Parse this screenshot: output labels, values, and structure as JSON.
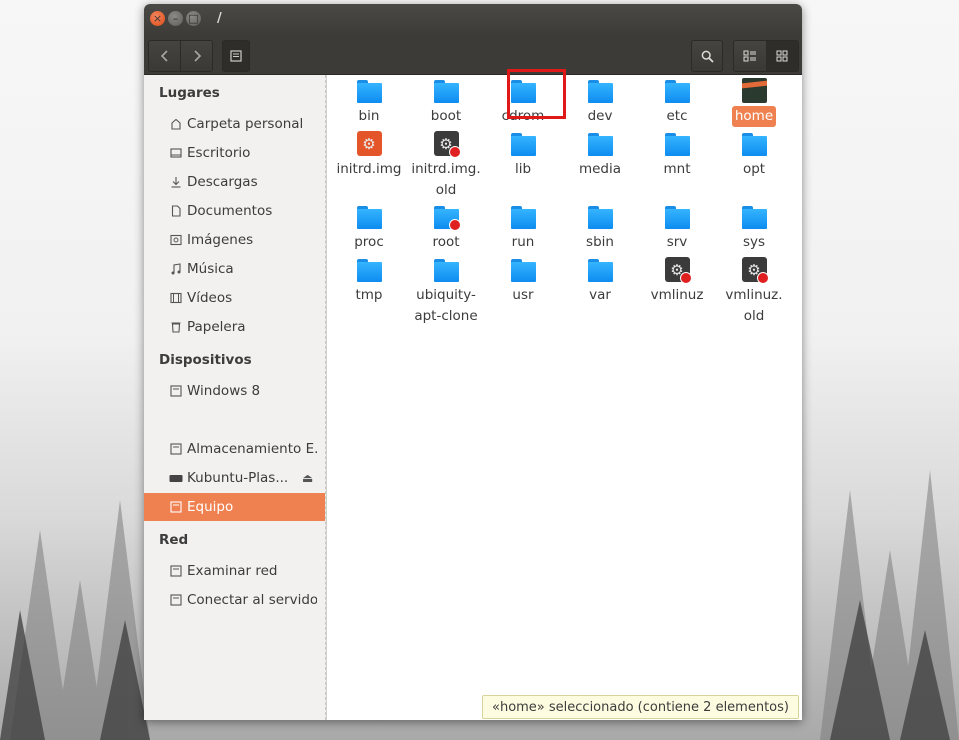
{
  "window": {
    "title": "/",
    "buttons": {
      "close": "×",
      "minimize": "–",
      "maximize": "□"
    }
  },
  "toolbar": {
    "back_icon": "chevron-left-icon",
    "forward_icon": "chevron-right-icon",
    "path_icon": "drive-icon",
    "search_icon": "search-icon",
    "list_view_icon": "list-view-icon",
    "grid_view_icon": "grid-view-icon"
  },
  "sidebar": {
    "sections": [
      {
        "heading": "Lugares",
        "items": [
          {
            "label": "Carpeta personal",
            "icon": "home-icon"
          },
          {
            "label": "Escritorio",
            "icon": "desktop-icon"
          },
          {
            "label": "Descargas",
            "icon": "download-icon"
          },
          {
            "label": "Documentos",
            "icon": "document-icon"
          },
          {
            "label": "Imágenes",
            "icon": "image-icon"
          },
          {
            "label": "Música",
            "icon": "music-icon"
          },
          {
            "label": "Vídeos",
            "icon": "video-icon"
          },
          {
            "label": "Papelera",
            "icon": "trash-icon"
          }
        ]
      },
      {
        "heading": "Dispositivos",
        "items": [
          {
            "label": "Windows 8",
            "icon": "drive-icon"
          },
          {
            "label": "Almacenamiento E...",
            "icon": "drive-icon"
          },
          {
            "label": "Kubuntu-Plas...",
            "icon": "disc-icon",
            "eject": "⏏"
          },
          {
            "label": "Equipo",
            "icon": "computer-icon",
            "selected": true
          }
        ]
      },
      {
        "heading": "Red",
        "items": [
          {
            "label": "Examinar red",
            "icon": "network-icon"
          },
          {
            "label": "Conectar al servidor",
            "icon": "server-icon"
          }
        ]
      }
    ]
  },
  "files": [
    {
      "name": "bin",
      "type": "folder"
    },
    {
      "name": "boot",
      "type": "folder"
    },
    {
      "name": "cdrom",
      "type": "folder"
    },
    {
      "name": "dev",
      "type": "folder"
    },
    {
      "name": "etc",
      "type": "folder",
      "highlighted": true
    },
    {
      "name": "home",
      "type": "home",
      "selected": true
    },
    {
      "name": "initrd.img",
      "type": "exec-orange"
    },
    {
      "name": "initrd.img.\nold",
      "type": "exec-locked"
    },
    {
      "name": "lib",
      "type": "folder"
    },
    {
      "name": "media",
      "type": "folder"
    },
    {
      "name": "mnt",
      "type": "folder"
    },
    {
      "name": "opt",
      "type": "folder"
    },
    {
      "name": "proc",
      "type": "folder"
    },
    {
      "name": "root",
      "type": "folder-locked"
    },
    {
      "name": "run",
      "type": "folder"
    },
    {
      "name": "sbin",
      "type": "folder"
    },
    {
      "name": "srv",
      "type": "folder"
    },
    {
      "name": "sys",
      "type": "folder"
    },
    {
      "name": "tmp",
      "type": "folder"
    },
    {
      "name": "ubiquity-\napt-clone",
      "type": "folder"
    },
    {
      "name": "usr",
      "type": "folder"
    },
    {
      "name": "var",
      "type": "folder"
    },
    {
      "name": "vmlinuz",
      "type": "exec-locked"
    },
    {
      "name": "vmlinuz.\nold",
      "type": "exec-locked"
    }
  ],
  "status": "«home» seleccionado  (contiene 2 elementos)",
  "colors": {
    "accent": "#ef8150",
    "folder": "#1a9af0",
    "highlight_box": "#e01818",
    "titlebar": "#3c3b37"
  }
}
